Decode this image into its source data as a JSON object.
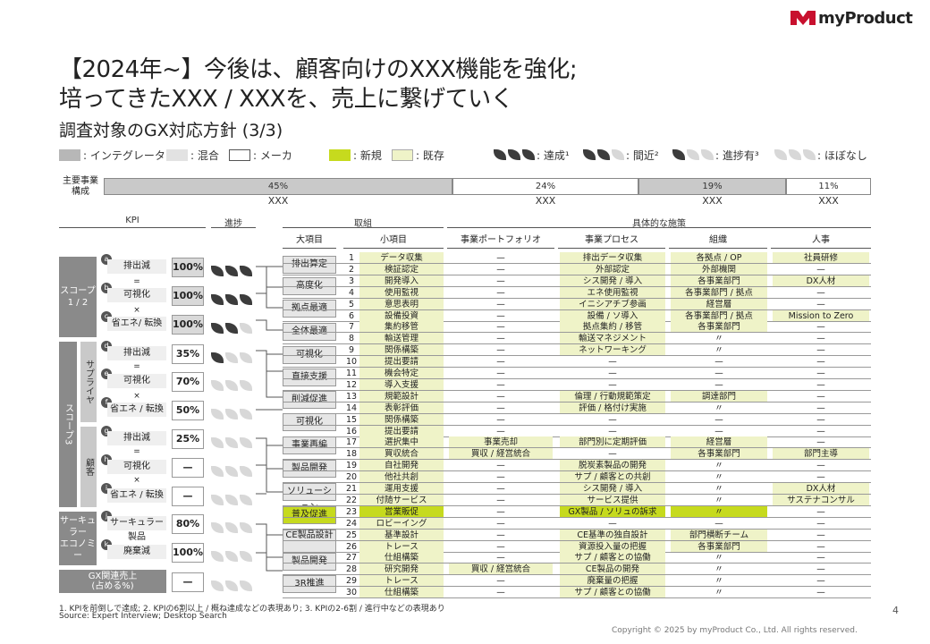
{
  "brand": {
    "name": "myProduct",
    "color": "#c8102e"
  },
  "title_line1": "【2024年~】今後は、顧客向けのXXX機能を強化;",
  "title_line2": "培ってきたXXX / XXXを、売上に繋げていく",
  "subtitle": "調査対象のGX対応方針 (3/3)",
  "legend": {
    "integrator": ": インテグレータ",
    "mixed": ": 混合",
    "maker": ": メーカ",
    "new": ": 新規",
    "existing": ": 既存",
    "achieved": ": 達成¹",
    "near": ": 間近²",
    "progress": ": 進捗有³",
    "none": ": ほぼなし"
  },
  "business": {
    "label": "主要事業\n構成",
    "label1": "主要事業",
    "label2": "構成",
    "segments": [
      {
        "pct": "45%",
        "name": "XXX",
        "share": 45,
        "color": "#c9c9c9"
      },
      {
        "pct": "24%",
        "name": "XXX",
        "share": 24,
        "color": "#ffffff"
      },
      {
        "pct": "19%",
        "name": "XXX",
        "share": 19,
        "color": "#c9c9c9"
      },
      {
        "pct": "11%",
        "name": "XXX",
        "share": 11,
        "color": "#ffffff"
      }
    ]
  },
  "headers": {
    "kpi": "KPI",
    "progress": "進捗",
    "efforts": "取組",
    "measures": "具体的な施策",
    "major": "大項目",
    "minor": "小項目",
    "portfolio": "事業ポートフォリオ",
    "process": "事業プロセス",
    "org": "組織",
    "hr": "人事"
  },
  "scopes": {
    "s12": "スコープ\n1 / 2",
    "s12a": "スコープ",
    "s12b": "1 / 2",
    "s3": "スコープ3",
    "supplier": "サプライヤ",
    "customer": "顧客",
    "circular": "サーキュラー\nエコノミー",
    "circ1": "サーキュ",
    "circ2": "ラー",
    "circ3": "エコノミー",
    "gx": "GX関連売上\n(占める%)",
    "gx1": "GX関連売上",
    "gx2": "(占める%)"
  },
  "kpis": [
    {
      "id": "a",
      "label": "排出減",
      "value": "100%",
      "leaves": 3
    },
    {
      "id": "b",
      "label": "可視化",
      "value": "100%",
      "leaves": 3
    },
    {
      "id": "c",
      "label": "省エネ/ 転換",
      "value": "100%",
      "leaves": 2
    },
    {
      "id": "d",
      "label": "排出減",
      "value": "35%",
      "leaves": 1
    },
    {
      "id": "e",
      "label": "可視化",
      "value": "70%",
      "leaves": 0
    },
    {
      "id": "f",
      "label": "省エネ / 転換",
      "value": "50%",
      "leaves": 0
    },
    {
      "id": "g",
      "label": "排出減",
      "value": "25%",
      "leaves": 0
    },
    {
      "id": "h",
      "label": "可視化",
      "value": "—",
      "leaves": 0
    },
    {
      "id": "i",
      "label": "省エネ / 転換",
      "value": "—",
      "leaves": 0
    },
    {
      "id": "j",
      "label": "サーキュラー製品",
      "value": "80%",
      "leaves": 0
    },
    {
      "id": "k",
      "label": "廃棄減",
      "value": "100%",
      "leaves": 0
    },
    {
      "id": "gx",
      "label": "",
      "value": "—",
      "leaves": 0
    }
  ],
  "kpi_ops": {
    "eq": "=",
    "x": "×"
  },
  "categories": [
    "排出算定",
    "高度化",
    "拠点最適",
    "全体最適",
    "可視化",
    "直接支援",
    "削減促進",
    "可視化",
    "事業再編",
    "製品開発",
    "ソリューション",
    "普及促進",
    "CE製品設計",
    "製品開発",
    "3R推進"
  ],
  "rows": [
    {
      "n": "1",
      "item": "データ収集",
      "pf": "—",
      "proc": "排出データ収集",
      "org": "各拠点 / OP",
      "hr": "社員研修",
      "t": [
        "e",
        "n",
        "e",
        "e",
        "e"
      ]
    },
    {
      "n": "2",
      "item": "検証認定",
      "pf": "—",
      "proc": "外部認定",
      "org": "外部機関",
      "hr": "—",
      "t": [
        "e",
        "n",
        "e",
        "e",
        "n"
      ]
    },
    {
      "n": "3",
      "item": "開発導入",
      "pf": "—",
      "proc": "シス開発 / 導入",
      "org": "各事業部門",
      "hr": "DX人材",
      "t": [
        "e",
        "n",
        "e",
        "e",
        "e"
      ]
    },
    {
      "n": "4",
      "item": "使用監視",
      "pf": "—",
      "proc": "エネ使用監視",
      "org": "各事業部門 / 拠点",
      "hr": "—",
      "t": [
        "e",
        "n",
        "e",
        "e",
        "n"
      ]
    },
    {
      "n": "5",
      "item": "意思表明",
      "pf": "—",
      "proc": "イニシアチブ参画",
      "org": "経営層",
      "hr": "—",
      "t": [
        "e",
        "n",
        "e",
        "e",
        "n"
      ]
    },
    {
      "n": "6",
      "item": "設備投資",
      "pf": "—",
      "proc": "設備 / ソ導入",
      "org": "各事業部門 / 拠点",
      "hr": "Mission to Zero",
      "t": [
        "e",
        "n",
        "e",
        "e",
        "e"
      ]
    },
    {
      "n": "7",
      "item": "集約移管",
      "pf": "—",
      "proc": "拠点集約 / 移管",
      "org": "各事業部門",
      "hr": "—",
      "t": [
        "e",
        "n",
        "e",
        "e",
        "n"
      ]
    },
    {
      "n": "8",
      "item": "輸送管理",
      "pf": "—",
      "proc": "輸送マネジメント",
      "org": "〃",
      "hr": "—",
      "t": [
        "e",
        "n",
        "e",
        "n",
        "n"
      ]
    },
    {
      "n": "9",
      "item": "関係構築",
      "pf": "—",
      "proc": "ネットワーキング",
      "org": "〃",
      "hr": "—",
      "t": [
        "e",
        "n",
        "e",
        "n",
        "n"
      ]
    },
    {
      "n": "10",
      "item": "提出要請",
      "pf": "—",
      "proc": "—",
      "org": "—",
      "hr": "—",
      "t": [
        "e",
        "n",
        "n",
        "n",
        "n"
      ]
    },
    {
      "n": "11",
      "item": "機会特定",
      "pf": "—",
      "proc": "—",
      "org": "—",
      "hr": "—",
      "t": [
        "e",
        "n",
        "n",
        "n",
        "n"
      ]
    },
    {
      "n": "12",
      "item": "導入支援",
      "pf": "—",
      "proc": "—",
      "org": "—",
      "hr": "—",
      "t": [
        "e",
        "n",
        "n",
        "n",
        "n"
      ]
    },
    {
      "n": "13",
      "item": "規範設計",
      "pf": "—",
      "proc": "倫理 / 行動規範策定",
      "org": "調達部門",
      "hr": "—",
      "t": [
        "e",
        "n",
        "e",
        "e",
        "n"
      ]
    },
    {
      "n": "14",
      "item": "表彰評価",
      "pf": "—",
      "proc": "評価 / 格付け実施",
      "org": "〃",
      "hr": "—",
      "t": [
        "e",
        "n",
        "e",
        "n",
        "n"
      ]
    },
    {
      "n": "15",
      "item": "関係構築",
      "pf": "—",
      "proc": "—",
      "org": "—",
      "hr": "—",
      "t": [
        "e",
        "n",
        "n",
        "n",
        "n"
      ]
    },
    {
      "n": "16",
      "item": "提出要請",
      "pf": "—",
      "proc": "—",
      "org": "—",
      "hr": "—",
      "t": [
        "e",
        "n",
        "n",
        "n",
        "n"
      ]
    },
    {
      "n": "17",
      "item": "選択集中",
      "pf": "事業売却",
      "proc": "部門別に定期評価",
      "org": "経営層",
      "hr": "—",
      "t": [
        "e",
        "e",
        "e",
        "e",
        "n"
      ]
    },
    {
      "n": "18",
      "item": "買収統合",
      "pf": "買収 / 経営統合",
      "proc": "—",
      "org": "各事業部門",
      "hr": "部門主導",
      "t": [
        "e",
        "e",
        "n",
        "e",
        "e"
      ]
    },
    {
      "n": "19",
      "item": "自社開発",
      "pf": "—",
      "proc": "脱炭素製品の開発",
      "org": "〃",
      "hr": "—",
      "t": [
        "e",
        "n",
        "e",
        "n",
        "n"
      ]
    },
    {
      "n": "20",
      "item": "他社共創",
      "pf": "—",
      "proc": "サプ / 顧客との共創",
      "org": "〃",
      "hr": "—",
      "t": [
        "e",
        "n",
        "e",
        "n",
        "n"
      ]
    },
    {
      "n": "21",
      "item": "運用支援",
      "pf": "—",
      "proc": "シス開発 / 導入",
      "org": "〃",
      "hr": "DX人材",
      "t": [
        "e",
        "n",
        "e",
        "n",
        "e"
      ]
    },
    {
      "n": "22",
      "item": "付随サービス",
      "pf": "—",
      "proc": "サービス提供",
      "org": "〃",
      "hr": "サステナコンサル",
      "t": [
        "e",
        "n",
        "e",
        "n",
        "e"
      ]
    },
    {
      "n": "23",
      "item": "営業販促",
      "pf": "—",
      "proc": "GX製品 / ソリュの訴求",
      "org": "〃",
      "hr": "—",
      "t": [
        "N",
        "n",
        "N",
        "N",
        "n"
      ]
    },
    {
      "n": "24",
      "item": "ロビーイング",
      "pf": "—",
      "proc": "—",
      "org": "—",
      "hr": "—",
      "t": [
        "e",
        "n",
        "n",
        "n",
        "n"
      ]
    },
    {
      "n": "25",
      "item": "基準設計",
      "pf": "—",
      "proc": "CE基準の独自設計",
      "org": "部門横断チーム",
      "hr": "—",
      "t": [
        "e",
        "n",
        "e",
        "e",
        "n"
      ]
    },
    {
      "n": "26",
      "item": "トレース",
      "pf": "—",
      "proc": "資源投入量の把握",
      "org": "各事業部門",
      "hr": "—",
      "t": [
        "e",
        "n",
        "e",
        "e",
        "n"
      ]
    },
    {
      "n": "27",
      "item": "仕組構築",
      "pf": "—",
      "proc": "サプ / 顧客との協働",
      "org": "〃",
      "hr": "—",
      "t": [
        "e",
        "n",
        "e",
        "n",
        "n"
      ]
    },
    {
      "n": "28",
      "item": "研究開発",
      "pf": "買収 / 経営統合",
      "proc": "CE製品の開発",
      "org": "〃",
      "hr": "—",
      "t": [
        "e",
        "e",
        "e",
        "n",
        "n"
      ]
    },
    {
      "n": "29",
      "item": "トレース",
      "pf": "—",
      "proc": "廃棄量の把握",
      "org": "〃",
      "hr": "—",
      "t": [
        "e",
        "n",
        "e",
        "n",
        "n"
      ]
    },
    {
      "n": "30",
      "item": "仕組構築",
      "pf": "—",
      "proc": "サプ / 顧客との協働",
      "org": "〃",
      "hr": "—",
      "t": [
        "e",
        "n",
        "e",
        "n",
        "n"
      ]
    }
  ],
  "colors": {
    "new": "#c6da1e",
    "existing": "#eff3c8",
    "integrator": "#b7b7b7",
    "mixed": "#e2e2e2"
  },
  "footnote1": "1. KPIを前倒しで達成; 2. KPIの6割以上 / 概ね達成などの表現あり; 3. KPIの2-6割 / 進行中などの表現あり",
  "footnote2": "Source: Expert Interview; Desktop Search",
  "page": "4",
  "copyright": "Copyright © 2025 by myProduct Co., Ltd.  All rights reserved."
}
